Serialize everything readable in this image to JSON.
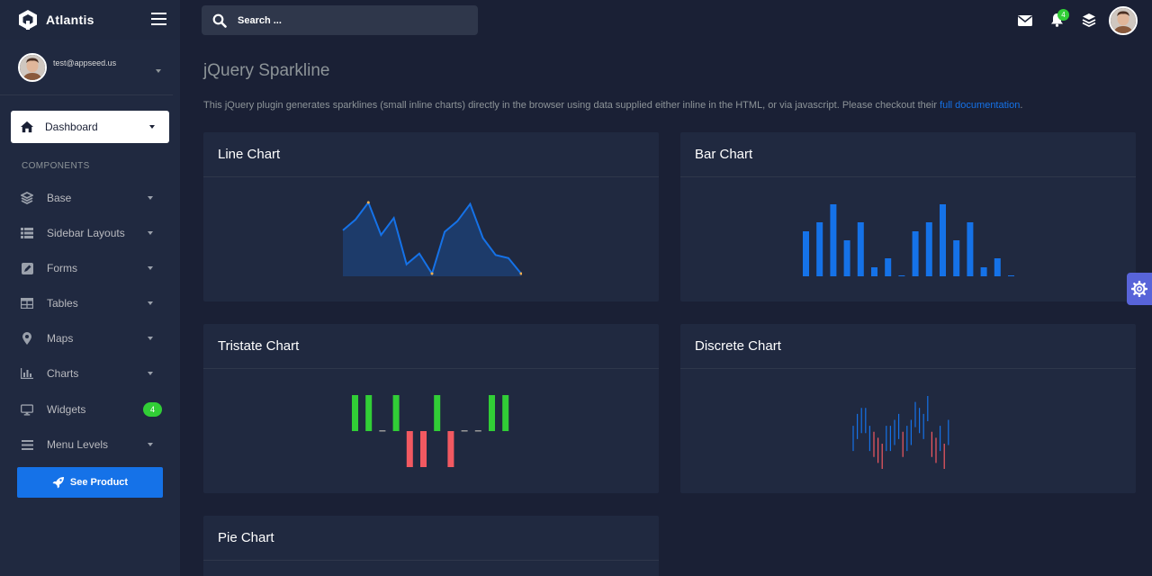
{
  "brand": {
    "name": "Atlantis"
  },
  "user": {
    "email": "test@appseed.us"
  },
  "sidebar": {
    "dashboard_label": "Dashboard",
    "section_title": "COMPONENTS",
    "items": [
      {
        "label": "Base",
        "icon": "layers-icon"
      },
      {
        "label": "Sidebar Layouts",
        "icon": "th-list-icon"
      },
      {
        "label": "Forms",
        "icon": "pen-square-icon"
      },
      {
        "label": "Tables",
        "icon": "table-icon"
      },
      {
        "label": "Maps",
        "icon": "map-marker-icon"
      },
      {
        "label": "Charts",
        "icon": "bar-chart-icon"
      },
      {
        "label": "Widgets",
        "icon": "desktop-icon",
        "badge": "4"
      },
      {
        "label": "Menu Levels",
        "icon": "bars-icon"
      }
    ],
    "cta_label": "See Product"
  },
  "topbar": {
    "search_placeholder": "Search ...",
    "notifications_count": "4"
  },
  "page": {
    "title": "jQuery Sparkline",
    "description": "This jQuery plugin generates sparklines (small inline charts) directly in the browser using data supplied either inline in the HTML, or via javascript. Please checkout their ",
    "link_text": "full documentation",
    "description_end": "."
  },
  "cards": {
    "line": "Line Chart",
    "bar": "Bar Chart",
    "tristate": "Tristate Chart",
    "discrete": "Discrete Chart",
    "pie": "Pie Chart"
  },
  "colors": {
    "accent": "#1572e8",
    "success": "#31ce36",
    "danger": "#f25961",
    "sidebar": "#202940",
    "background": "#1a2035"
  },
  "chart_data": [
    {
      "type": "line",
      "title": "Line Chart",
      "values": [
        102,
        109,
        120,
        99,
        110,
        80,
        87,
        74,
        101,
        108,
        119,
        97,
        86,
        84,
        74
      ],
      "color": "#1572e8"
    },
    {
      "type": "bar",
      "title": "Bar Chart",
      "values": [
        5,
        6,
        8,
        4,
        6,
        1,
        2,
        0,
        5,
        6,
        8,
        4,
        6,
        1,
        2,
        0
      ],
      "color": "#1572e8"
    },
    {
      "type": "tristate",
      "title": "Tristate Chart",
      "values": [
        1,
        1,
        0,
        1,
        -1,
        -1,
        1,
        -1,
        0,
        0,
        1,
        1
      ],
      "colors": {
        "positive": "#31ce36",
        "negative": "#f25961",
        "zero": "#999999"
      }
    },
    {
      "type": "discrete",
      "title": "Discrete Chart",
      "values": [
        4,
        6,
        7,
        7,
        4,
        3,
        2,
        1,
        4,
        4,
        5,
        6,
        3,
        4,
        5,
        8,
        7,
        6,
        9,
        3,
        2,
        4,
        1,
        5
      ],
      "threshold": 3,
      "colors": {
        "above": "#1572e8",
        "below": "#f25961"
      }
    }
  ]
}
